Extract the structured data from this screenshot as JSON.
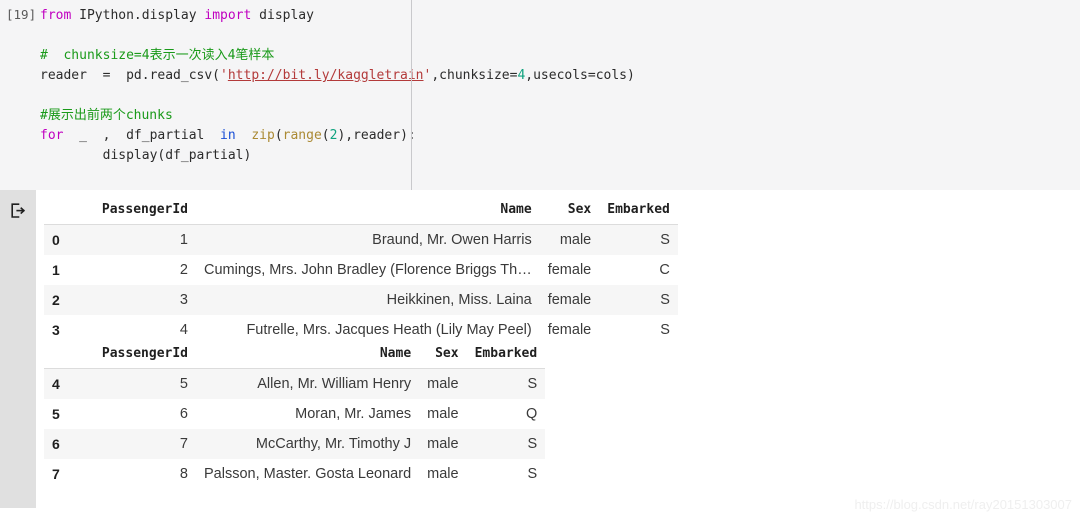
{
  "notebook": {
    "cell_prompt": "[19]",
    "code_lines": [
      [
        {
          "t": "from ",
          "c": "kw"
        },
        {
          "t": "IPython.display ",
          "c": "plain"
        },
        {
          "t": "import ",
          "c": "kw"
        },
        {
          "t": "display",
          "c": "plain"
        }
      ],
      [],
      [
        {
          "t": "#  chunksize=4表示一次读入4笔样本",
          "c": "cmt"
        }
      ],
      [
        {
          "t": "reader  =  pd.read_csv(",
          "c": "plain"
        },
        {
          "t": "'",
          "c": "str"
        },
        {
          "t": "http://bit.ly/kaggletrain",
          "c": "link"
        },
        {
          "t": "'",
          "c": "str"
        },
        {
          "t": ",chunksize=",
          "c": "plain"
        },
        {
          "t": "4",
          "c": "num"
        },
        {
          "t": ",usecols=cols)",
          "c": "plain"
        }
      ],
      [],
      [
        {
          "t": "#展示出前两个chunks",
          "c": "cmt"
        }
      ],
      [
        {
          "t": "for ",
          "c": "kw"
        },
        {
          "t": " _  ,  df_partial  ",
          "c": "plain"
        },
        {
          "t": "in ",
          "c": "kw2"
        },
        {
          "t": " zip",
          "c": "fn"
        },
        {
          "t": "(",
          "c": "plain"
        },
        {
          "t": "range",
          "c": "fn"
        },
        {
          "t": "(",
          "c": "plain"
        },
        {
          "t": "2",
          "c": "num"
        },
        {
          "t": "),reader):",
          "c": "plain"
        }
      ],
      [
        {
          "t": "        display(df_partial)",
          "c": "plain"
        }
      ]
    ]
  },
  "output": {
    "icon": "output-arrow-icon",
    "tables": [
      {
        "columns": [
          "",
          "PassengerId",
          "Name",
          "Sex",
          "Embarked"
        ],
        "rows": [
          {
            "index": "0",
            "PassengerId": "1",
            "Name": "Braund, Mr. Owen Harris",
            "Sex": "male",
            "Embarked": "S"
          },
          {
            "index": "1",
            "PassengerId": "2",
            "Name": "Cumings, Mrs. John Bradley (Florence Briggs Th…",
            "Sex": "female",
            "Embarked": "C"
          },
          {
            "index": "2",
            "PassengerId": "3",
            "Name": "Heikkinen, Miss. Laina",
            "Sex": "female",
            "Embarked": "S"
          },
          {
            "index": "3",
            "PassengerId": "4",
            "Name": "Futrelle, Mrs. Jacques Heath (Lily May Peel)",
            "Sex": "female",
            "Embarked": "S"
          }
        ]
      },
      {
        "columns": [
          "",
          "PassengerId",
          "Name",
          "Sex",
          "Embarked"
        ],
        "rows": [
          {
            "index": "4",
            "PassengerId": "5",
            "Name": "Allen, Mr. William Henry",
            "Sex": "male",
            "Embarked": "S"
          },
          {
            "index": "5",
            "PassengerId": "6",
            "Name": "Moran, Mr. James",
            "Sex": "male",
            "Embarked": "Q"
          },
          {
            "index": "6",
            "PassengerId": "7",
            "Name": "McCarthy, Mr. Timothy J",
            "Sex": "male",
            "Embarked": "S"
          },
          {
            "index": "7",
            "PassengerId": "8",
            "Name": "Palsson, Master. Gosta Leonard",
            "Sex": "male",
            "Embarked": "S"
          }
        ]
      }
    ]
  },
  "watermark": {
    "text": "https://blog.csdn.net/ray20151303007"
  },
  "colors": {
    "cell_background": "#f5f5f6",
    "gutter": "#e0e0e0",
    "row_stripe": "#f6f6f6",
    "keyword": "#c000c0",
    "keyword_alt": "#1a4fd6",
    "function": "#ab8a34",
    "string": "#b33a3a",
    "number": "#10a37f",
    "comment": "#1a9a1a"
  }
}
